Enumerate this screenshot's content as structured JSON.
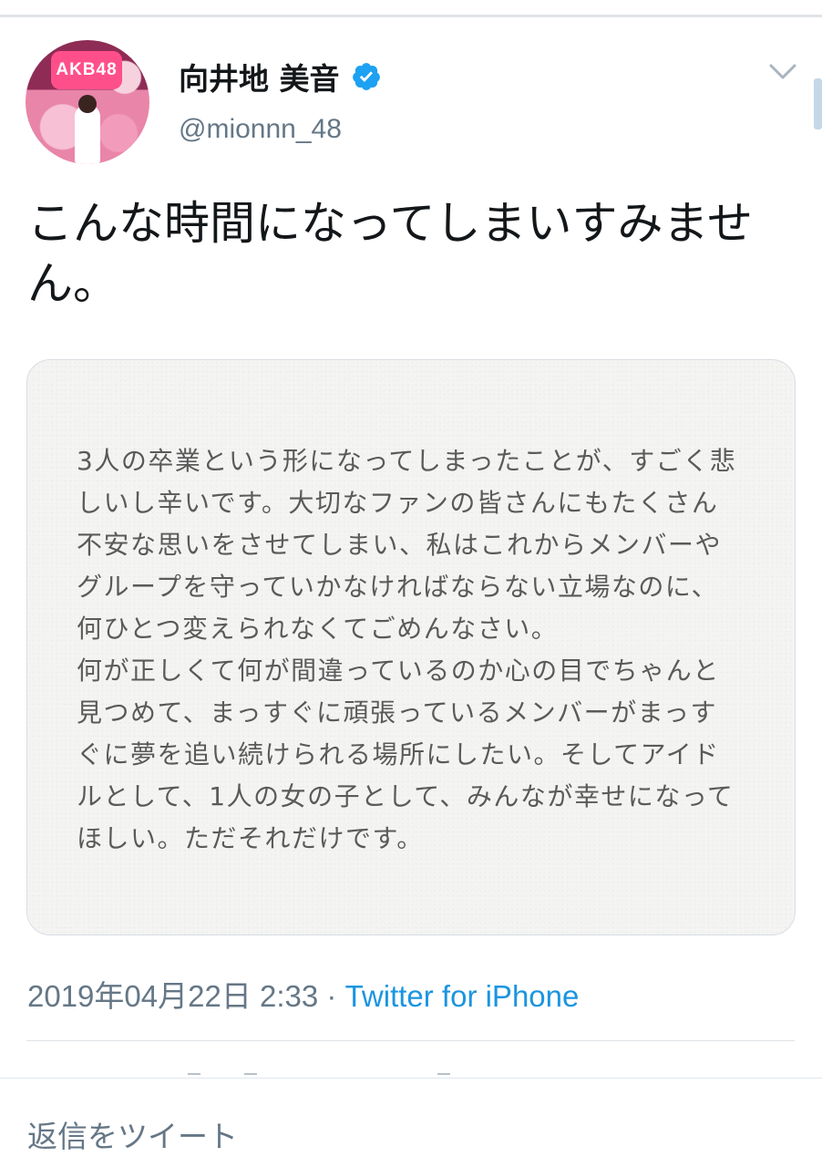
{
  "user": {
    "display_name": "向井地 美音",
    "handle": "@mionnn_48",
    "verified": true,
    "avatar_sign": "AKB48"
  },
  "tweet": {
    "text": "こんな時間になってしまいすみません。",
    "timestamp": "2019年04月22日 2:33",
    "separator": "·",
    "source": "Twitter for iPhone"
  },
  "media": {
    "lines": [
      "3人の卒業という形になってしまったことが、すごく悲",
      "しいし辛いです。大切なファンの皆さんにもたくさん",
      "不安な思いをさせてしまい、私はこれからメンバーや",
      "グループを守っていかなければならない立場なのに、",
      "何ひとつ変えられなくてごめんなさい。",
      "何が正しくて何が間違っているのか心の目でちゃんと",
      "見つめて、まっすぐに頑張っているメンバーがまっす",
      "ぐに夢を追い続けられる場所にしたい。そしてアイド",
      "ルとして、1人の女の子として、みんなが幸せになって",
      "ほしい。ただそれだけです。"
    ]
  },
  "reply": {
    "placeholder": "返信をツイート"
  },
  "colors": {
    "accent": "#1b95e0",
    "verified_badge": "#1da1f2",
    "secondary_text": "#657786"
  },
  "icons": {
    "verified": "verified-badge-icon",
    "menu": "chevron-down-icon"
  }
}
